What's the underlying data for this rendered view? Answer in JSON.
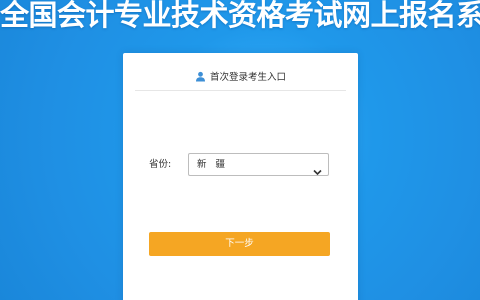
{
  "header": {
    "title": "全国会计专业技术资格考试网上报名系统"
  },
  "login_card": {
    "title": "首次登录考生入口",
    "province_label": "省份:",
    "province_value": "新 疆",
    "next_button_label": "下一步"
  },
  "icons": {
    "user": "user-icon",
    "dropdown": "chevron-down-icon"
  },
  "colors": {
    "background": "#1f8fe3",
    "button": "#f5a623",
    "user_icon": "#3d8fd6"
  }
}
